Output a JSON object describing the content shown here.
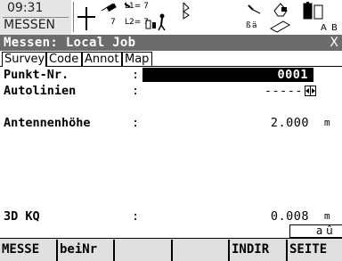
{
  "status": {
    "time": "09:31",
    "mode": "MESSEN",
    "l1_count": "L1= 7",
    "l2_count": "L2= 7",
    "sats": "7",
    "icons": [
      "gps-antenna-icon",
      "satellite-icon",
      "position-mode-icon",
      "bluetooth-icon",
      "radio-icon",
      "memory-card-icon",
      "battery-icon"
    ],
    "battery_labels": [
      "A",
      "B"
    ]
  },
  "title": {
    "text": "Messen: Local Job",
    "close": "X"
  },
  "tabs": [
    {
      "label": "Survey",
      "active": true
    },
    {
      "label": "Code",
      "active": false
    },
    {
      "label": "Annot",
      "active": false
    },
    {
      "label": "Map",
      "active": false
    }
  ],
  "fields": {
    "punkt_nr": {
      "label": "Punkt-Nr.",
      "sep": ":",
      "value": "0001"
    },
    "autolinien": {
      "label": "Autolinien",
      "sep": ":",
      "value": "-----"
    },
    "antennenhoehe": {
      "label": "Antennenhöhe",
      "sep": ":",
      "value": "2.000",
      "unit": "m"
    },
    "kq3d": {
      "label": "3D KQ",
      "sep": ":",
      "value": "0.008",
      "unit": "m"
    }
  },
  "indicator": "a û",
  "softkeys": [
    "MESSE",
    "beiNr",
    "",
    "",
    "INDIR",
    "SEITE"
  ]
}
